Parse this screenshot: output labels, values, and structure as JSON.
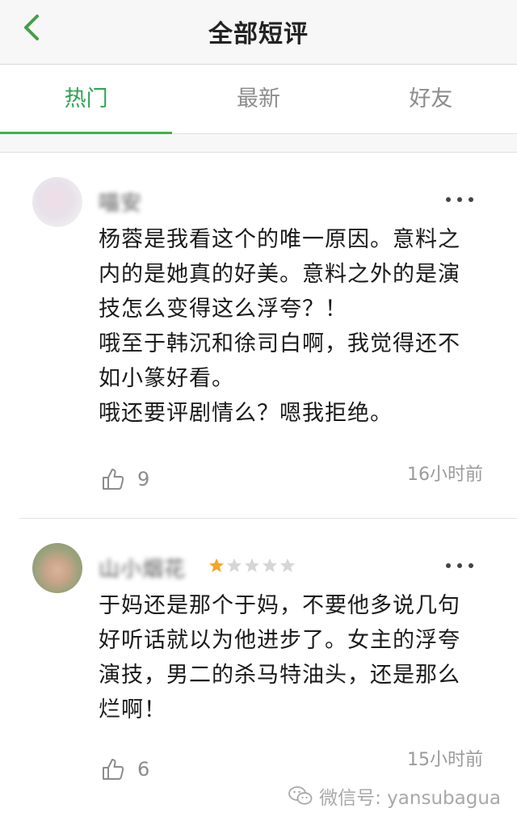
{
  "header": {
    "title": "全部短评"
  },
  "tabs": [
    {
      "label": "热门",
      "active": true
    },
    {
      "label": "最新",
      "active": false
    },
    {
      "label": "好友",
      "active": false
    }
  ],
  "comments": [
    {
      "username": "喵安",
      "stars": null,
      "text_lines": [
        "杨蓉是我看这个的唯一原因。意料之",
        "内的是她真的好美。意料之外的是演",
        "技怎么变得这么浮夸？！",
        "哦至于韩沉和徐司白啊，我觉得还不",
        "如小篆好看。",
        "哦还要评剧情么？嗯我拒绝。"
      ],
      "likes": "9",
      "time": "16小时前"
    },
    {
      "username": "山小烟花",
      "stars": {
        "filled": 1,
        "total": 5
      },
      "text_lines": [
        "于妈还是那个于妈，不要他多说几句",
        "好听话就以为他进步了。女主的浮夸",
        "演技，男二的杀马特油头，还是那么",
        "烂啊！"
      ],
      "likes": "6",
      "time": "15小时前"
    }
  ],
  "watermark": {
    "text": "微信号: yansubagua"
  },
  "colors": {
    "accent": "#2ea44f",
    "star_filled": "#f5a623",
    "star_empty": "#d6d6d6"
  }
}
